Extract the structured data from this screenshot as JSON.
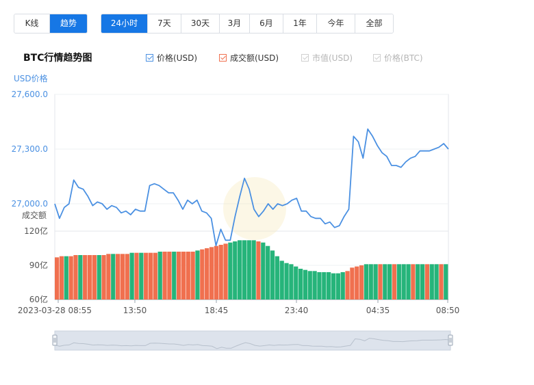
{
  "toggle_views": [
    {
      "label": "K线",
      "active": false
    },
    {
      "label": "趋势",
      "active": true
    }
  ],
  "ranges": [
    {
      "label": "24小时",
      "active": true
    },
    {
      "label": "7天",
      "active": false
    },
    {
      "label": "30天",
      "active": false
    },
    {
      "label": "3月",
      "active": false
    },
    {
      "label": "6月",
      "active": false
    },
    {
      "label": "1年",
      "active": false
    },
    {
      "label": "今年",
      "active": false
    },
    {
      "label": "全部",
      "active": false
    }
  ],
  "chart_title": "BTC行情趋势图",
  "legend": [
    {
      "label": "价格(USD)",
      "checked": true,
      "color": "#4a90e2",
      "enabled": true
    },
    {
      "label": "成交额(USD)",
      "checked": true,
      "color": "#f0704f",
      "enabled": true
    },
    {
      "label": "市值(USD)",
      "checked": true,
      "color": "#cfcfcf",
      "enabled": false
    },
    {
      "label": "价格(BTC)",
      "checked": true,
      "color": "#cfcfcf",
      "enabled": false
    }
  ],
  "colors": {
    "price_line": "#4a90e2",
    "vol_up": "#26b47a",
    "vol_down": "#f0704f",
    "axis_label_blue": "#4a90e2"
  },
  "chart_data": {
    "type": "line",
    "price_axis_label": "USD价格",
    "volume_axis_label": "成交额",
    "price_ticks": [
      "27,600.0",
      "27,300.0",
      "27,000.0"
    ],
    "price_ylim": [
      26850,
      27600
    ],
    "volume_ticks": [
      "120亿",
      "90亿",
      "60亿"
    ],
    "volume_ylim": [
      60,
      120
    ],
    "x_ticks": [
      "2023-03-28 08:55",
      "13:50",
      "18:45",
      "23:40",
      "04:35",
      "08:50"
    ],
    "grid": true,
    "price_series": {
      "name": "价格(USD)",
      "values": [
        27000,
        26920,
        26980,
        27000,
        27130,
        27090,
        27080,
        27040,
        26990,
        27010,
        27000,
        26970,
        26990,
        26980,
        26950,
        26960,
        26940,
        26970,
        26960,
        26960,
        27100,
        27110,
        27100,
        27080,
        27060,
        27060,
        27020,
        26970,
        27020,
        27000,
        27020,
        26960,
        26950,
        26920,
        26770,
        26860,
        26800,
        26800,
        26930,
        27040,
        27140,
        27080,
        26970,
        26930,
        26960,
        27000,
        26970,
        27000,
        26990,
        27000,
        27020,
        27030,
        26960,
        26960,
        26930,
        26920,
        26920,
        26890,
        26900,
        26870,
        26880,
        26930,
        26970,
        27370,
        27340,
        27250,
        27410,
        27370,
        27320,
        27280,
        27260,
        27210,
        27210,
        27200,
        27230,
        27250,
        27260,
        27290,
        27290,
        27290,
        27300,
        27310,
        27330,
        27300
      ]
    },
    "volume_series": {
      "name": "成交额(USD)",
      "values": [
        97,
        98,
        98,
        98,
        99,
        99,
        99,
        99,
        99,
        99,
        99,
        100,
        100,
        100,
        100,
        100,
        101,
        101,
        101,
        101,
        101,
        101,
        102,
        102,
        102,
        102,
        102,
        102,
        102,
        102,
        103,
        104,
        105,
        106,
        107,
        108,
        109,
        110,
        111,
        112,
        112,
        112,
        112,
        111,
        110,
        107,
        103,
        98,
        94,
        92,
        91,
        89,
        87,
        86,
        85,
        85,
        84,
        84,
        84,
        83,
        83,
        84,
        85,
        88,
        89,
        90,
        91,
        91,
        91,
        91,
        91,
        91,
        91,
        91,
        91,
        91,
        91,
        91,
        91,
        91,
        91,
        91,
        91,
        91
      ],
      "up": [
        0,
        0,
        1,
        0,
        0,
        1,
        0,
        0,
        0,
        1,
        0,
        0,
        1,
        0,
        0,
        0,
        1,
        0,
        1,
        0,
        0,
        0,
        1,
        0,
        0,
        1,
        0,
        0,
        0,
        0,
        1,
        0,
        0,
        0,
        0,
        0,
        0,
        1,
        1,
        1,
        1,
        1,
        1,
        0,
        1,
        1,
        1,
        1,
        1,
        1,
        1,
        1,
        1,
        1,
        1,
        1,
        1,
        1,
        1,
        1,
        1,
        1,
        0,
        0,
        0,
        0,
        1,
        1,
        1,
        0,
        1,
        1,
        0,
        1,
        1,
        1,
        0,
        1,
        1,
        0,
        1,
        1,
        0,
        1
      ]
    },
    "navigator": {
      "start": 0,
      "end": 1
    }
  }
}
